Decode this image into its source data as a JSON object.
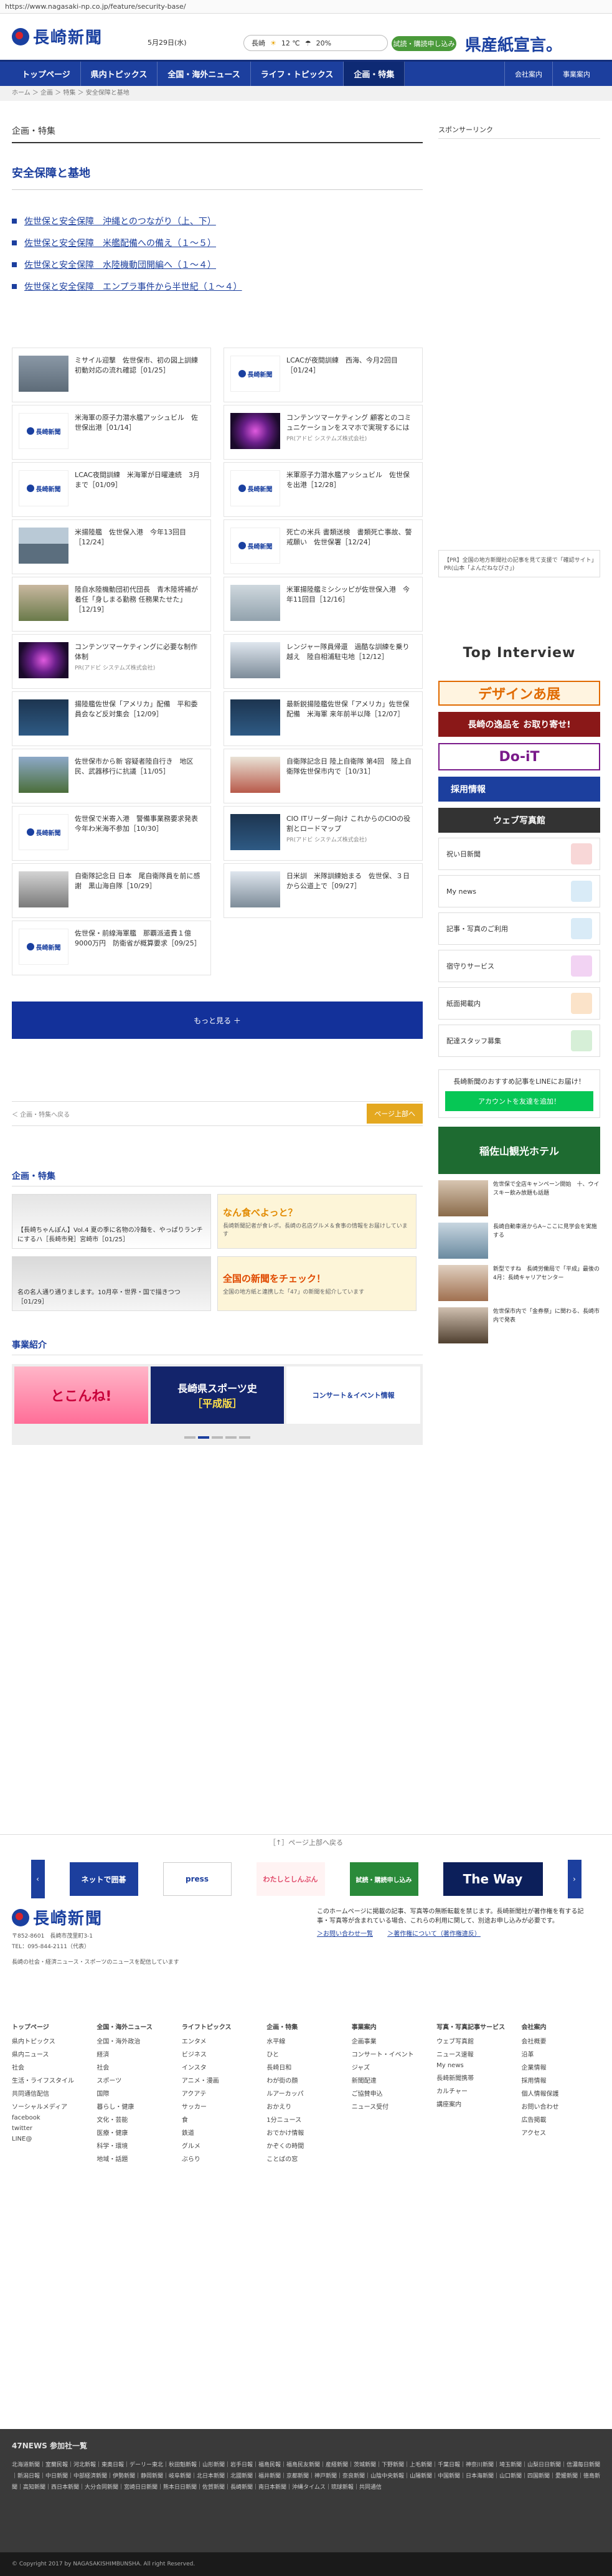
{
  "url": "https://www.nagasaki-np.co.jp/feature/security-base/",
  "header": {
    "logo_text": "長崎新聞",
    "date": "5月29日(水)",
    "weather_city": "長崎",
    "weather_temp": "12 ℃",
    "weather_rain": "20%",
    "green_button": "試読・購読申し込み",
    "kensan": "県産紙宣言。"
  },
  "nav": {
    "items": [
      "トップページ",
      "県内トピックス",
      "全国・海外ニュース",
      "ライフ・トピックス",
      "企画・特集"
    ],
    "company": "会社案内",
    "business": "事業案内"
  },
  "breadcrumb": "ホーム ＞ 企画 ＞ 特集 ＞ 安全保障と基地",
  "main": {
    "crumb_title": "企画・特集",
    "page_title": "安全保障と基地",
    "series": [
      "佐世保と安全保障　沖縄とのつながり（上、下）",
      "佐世保と安全保障　米艦配備への備え（１～５）",
      "佐世保と安全保障　水陸機動団開編へ（１～４）",
      "佐世保と安全保障　エンプラ事件から半世紀（１～４）"
    ],
    "cards": [
      {
        "text": "ミサイル迎撃　佐世保市、初の図上訓練　初動対応の流れ確認［01/25］",
        "thumb": "p1"
      },
      {
        "text": "LCACが夜間訓練　西海、今月2回目［01/24］",
        "thumb": "logo"
      },
      {
        "text": "米海軍の原子力潜水艦アッシュビル　佐世保出港［01/14］",
        "thumb": "logo"
      },
      {
        "text": "コンテンツマーケティング 顧客とのコミュニケーションをスマホで実現するには",
        "sub": "PR(アドビ システムズ株式会社)",
        "thumb": "p2"
      },
      {
        "text": "LCAC夜間訓練　米海軍が日曜連続　3月まで［01/09］",
        "thumb": "logo"
      },
      {
        "text": "米軍原子力潜水艦アッシュビル　佐世保を出港［12/28］",
        "thumb": "logo"
      },
      {
        "text": "米揚陸艦　佐世保入港　今年13回目［12/24］",
        "thumb": "p3"
      },
      {
        "text": "死亡の米兵 書類送検　書類死亡事故、警戒願い　佐世保署［12/24］",
        "thumb": "logo"
      },
      {
        "text": "陸自水陸機動団初代団長　青木陸将補が着任「身しまる勤務 任務果たせた」［12/19］",
        "thumb": "p5"
      },
      {
        "text": "米軍揚陸艦ミシシッピが佐世保入港　今年11回目［12/16］",
        "thumb": "p4"
      },
      {
        "text": "コンテンツマーケティングに必要な制作体制",
        "sub": "PR(アドビ システムズ株式会社)",
        "thumb": "p2"
      },
      {
        "text": "レンジャー隊員帰還　過酷な訓練を乗り越え　陸自相浦駐屯地［12/12］",
        "thumb": "p8"
      },
      {
        "text": "揚陸艦佐世保「アメリカ」配備　平和委員会など反対集会［12/09］",
        "thumb": "p6"
      },
      {
        "text": "最新鋭揚陸艦佐世保「アメリカ」佐世保配備　米海軍 来年前半以降［12/07］",
        "thumb": "p6"
      },
      {
        "text": "佐世保市から新 容疑者陸自行き　地区民、武器移行に抗議［11/05］",
        "thumb": "p9"
      },
      {
        "text": "自衛隊記念日 陸上自衛隊 第4回　陸上自衛隊佐世保市内で［10/31］",
        "thumb": "p7"
      },
      {
        "text": "佐世保で米寄入港　警備事業務要求発表　今年わ米海不参加［10/30］",
        "thumb": "logo"
      },
      {
        "text": "CIO ITリーダー向け これからのCIOの役割とロードマップ",
        "sub": "PR(アドビ システムズ株式会社)",
        "thumb": "p6"
      },
      {
        "text": "自衛隊記念日 日本　尾自衛隊員を前に感謝　黒山海自隊［10/29］",
        "thumb": "p10"
      },
      {
        "text": "日米訓　米隊訓練始まる　佐世保、３日から公道上で［09/27］",
        "thumb": "p8"
      },
      {
        "text": "佐世保・前線海軍艦　那覇派遣費１億9000万円　防衛省が概算要求［09/25］",
        "thumb": "logo"
      }
    ],
    "more_button": "もっと見る ＋",
    "pager_prev": "企画・特集へ戻る",
    "pager_top": "ページ上部へ",
    "feature_heading": "企画・特集",
    "feature_a": "【長崎ちゃんぽん】Vol.4 夏の季に名物の冷麺を、やっぱりランチにするハ［長崎市発］宮崎市［01/25］",
    "feature_b_title": "なん食べよっと？",
    "feature_b_desc": "長崎新聞記者が食レポ。長崎の名店グルメ＆食事の情報をお届けしています",
    "feature_c": "名の名人通り通りまします。10月卒・世界・国で描きつつ［01/29］",
    "feature_d_title": "全国の新聞をチェック！",
    "feature_d_desc": "全国の地方紙と連携した「47」の新聞を紹介しています",
    "business_heading": "事業紹介",
    "slides": [
      "とこんね!",
      "長崎県スポーツ史",
      "コンサート＆イベント情報"
    ],
    "slide2_sub": "［平成版］"
  },
  "side": {
    "sponsor": "スポンサーリンク",
    "ad_text": "【PR】全国の地方新聞社の記事を見て支援で「確認サイト」PR(山本「よんだねなびさ」)",
    "top_interview": "Top Interview",
    "design": "デザインあ展",
    "goods": "長崎の逸品を お取り寄せ!",
    "doit": "Do-iT",
    "recruit": "採用情報",
    "photo": "ウェブ写真館",
    "buttons": [
      "祝い日新聞",
      "My news",
      "記事・写真のご利用",
      "宿守りサービス",
      "紙面掲載内",
      "配達スタッフ募集"
    ],
    "line_title": "長崎新聞のおすすめ記事をLINEにお届け！",
    "line_button": "アカウントを友達を追加！",
    "hotel": "稲佐山観光ホテル",
    "news": [
      "佐世保で全店キャンペーン開始　十、ウイスキー飲み放題も話題",
      "長崎自動車道からA~ここに見学会を実施する",
      "新型ですね　長崎労働局で「平成」最後の4月：長崎キャリアセンター",
      "佐世保市内で「金券祭」に関わる、長崎市内で発表"
    ]
  },
  "bottom_slider": {
    "heading": "［↑］ページ上部へ戻る",
    "items": [
      "ネットで囲碁",
      "press",
      "わたしとしんぶん",
      "試読・購読申し込み",
      "The Way"
    ]
  },
  "footer": {
    "address": "〒852-8601　長崎市茂里町3-1",
    "tel": "TEL：095-844-2111（代表）",
    "tagline": "長崎の社会・経済ニュース・スポーツのニュースを配信しています",
    "note": "このホームページに掲載の記事、写真等の無断転載を禁じます。長崎新聞社が著作権を有する記事・写真等が含まれている場合、これらの利用に関して、別途お申し込みが必要です。",
    "link1": "＞お問い合わせ一覧",
    "link2": "＞著作権について（著作権違反）",
    "columns": [
      {
        "h": "トップページ",
        "items": [
          "県内トピックス",
          "県内ニュース",
          "社会",
          "生活・ライフスタイル",
          "共同通信配信",
          "ソーシャルメディア",
          "facebook",
          "twitter",
          "LINE@"
        ]
      },
      {
        "h": "全国・海外ニュース",
        "items": [
          "全国・海外政治",
          "経済",
          "社会",
          "スポーツ",
          "国際",
          "暮らし・健康",
          "文化・芸能",
          "医療・健康",
          "科学・環境",
          "地域・話題"
        ]
      },
      {
        "h": "ライフトピックス",
        "items": [
          "エンタメ",
          "ビジネス",
          "インスタ",
          "アニメ・漫画",
          "アクアテ",
          "サッカー",
          "食",
          "鉄道",
          "グルメ",
          "ぶらり"
        ]
      },
      {
        "h": "企画・特集",
        "items": [
          "水平線",
          "ひと",
          "長崎日和",
          "わが街の顔",
          "ルアーカッパ",
          "おかえり",
          "1分ニュース",
          "おでかけ情報",
          "かぞくの時間",
          "ことばの窓"
        ]
      },
      {
        "h": "事業案内",
        "items": [
          "企画事業",
          "コンサート・イベント",
          "ジャズ",
          "新聞配達",
          "ご協賛申込",
          "ニュース受付"
        ]
      },
      {
        "h": "写真・写真記事サービス",
        "items": [
          "ウェブ写真館",
          "ニュース速報",
          "My news",
          "長崎新聞携帯",
          "カルチャー",
          "講座案内"
        ]
      },
      {
        "h": "会社案内",
        "items": [
          "会社概要",
          "沿革",
          "企業情報",
          "採用情報",
          "個人情報保護",
          "お問い合わせ",
          "広告掲載",
          "アクセス"
        ]
      }
    ]
  },
  "news47": {
    "heading": "47NEWS 参加社一覧",
    "list": "北海道新聞｜室蘭民報｜河北新報｜東奥日報｜デーリー東北｜秋田魁新報｜山形新聞｜岩手日報｜福島民報｜福島民友新聞｜産経新聞｜茨城新聞｜下野新聞｜上毛新聞｜千葉日報｜神奈川新聞｜埼玉新聞｜山梨日日新聞｜信濃毎日新聞｜新潟日報｜中日新聞｜中部経済新聞｜伊勢新聞｜静岡新聞｜岐阜新聞｜北日本新聞｜北國新聞｜福井新聞｜京都新聞｜神戸新聞｜奈良新聞｜山陰中央新報｜山陽新聞｜中国新聞｜日本海新聞｜山口新聞｜四国新聞｜愛媛新聞｜徳島新聞｜高知新聞｜西日本新聞｜大分合同新聞｜宮崎日日新聞｜熊本日日新聞｜佐賀新聞｜長崎新聞｜南日本新聞｜沖縄タイムス｜琉球新報｜共同通信"
  },
  "copyright": "© Copyright 2017 by NAGASAKISHIMBUNSHA. All right Reserved."
}
